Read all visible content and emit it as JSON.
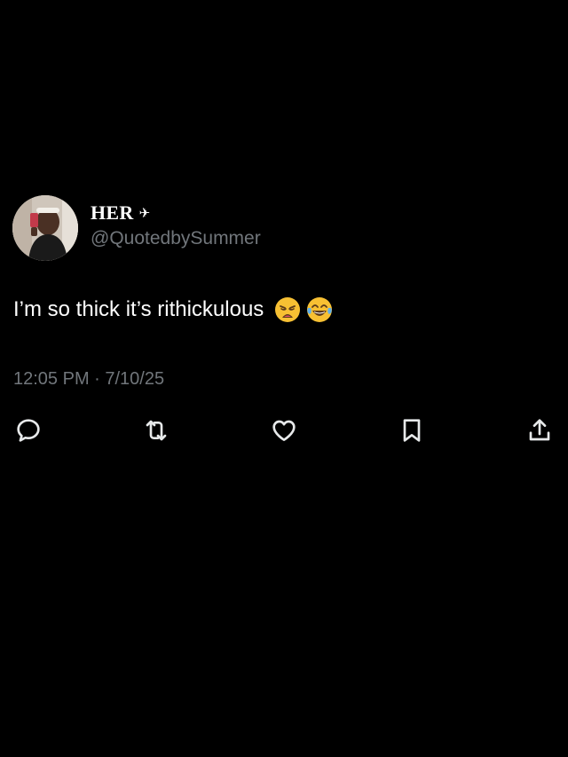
{
  "tweet": {
    "display_name": "HER",
    "name_badge_icon": "airplane-icon",
    "handle": "@QuotedbySummer",
    "text": "I’m so thick it’s rithickulous",
    "emojis": [
      "weary-face-emoji",
      "tears-of-joy-emoji"
    ],
    "timestamp": "12:05 PM · 7/10/25"
  },
  "actions": [
    {
      "name": "reply",
      "icon": "reply-icon"
    },
    {
      "name": "retweet",
      "icon": "retweet-icon"
    },
    {
      "name": "like",
      "icon": "heart-icon"
    },
    {
      "name": "bookmark",
      "icon": "bookmark-icon"
    },
    {
      "name": "share",
      "icon": "share-icon"
    }
  ],
  "colors": {
    "background": "#000000",
    "primary_text": "#ffffff",
    "secondary_text": "#71767b",
    "icon": "#e7e9ea"
  }
}
